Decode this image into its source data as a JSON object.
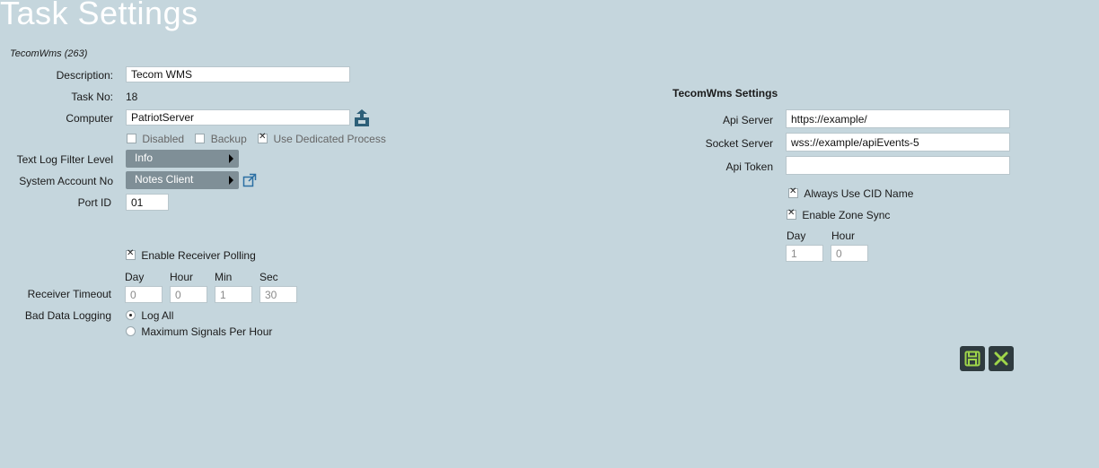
{
  "page": {
    "title": "Task Settings",
    "subtitle": "TecomWms (263)"
  },
  "left": {
    "description": {
      "label": "Description:",
      "value": "Tecom WMS"
    },
    "task_no": {
      "label": "Task No:",
      "value": "18"
    },
    "computer": {
      "label": "Computer",
      "value": "PatriotServer"
    },
    "options": {
      "disabled": {
        "label": "Disabled",
        "checked": false
      },
      "backup": {
        "label": "Backup",
        "checked": false
      },
      "dedicated": {
        "label": "Use Dedicated Process",
        "checked": true
      }
    },
    "log_filter": {
      "label": "Text Log Filter Level",
      "value": "Info"
    },
    "system_account": {
      "label": "System Account No",
      "value": "Notes Client"
    },
    "port_id": {
      "label": "Port ID",
      "value": "01"
    },
    "receiver_polling": {
      "label": "Enable Receiver Polling",
      "checked": true
    },
    "timeout_units": {
      "day": "Day",
      "hour": "Hour",
      "min": "Min",
      "sec": "Sec"
    },
    "receiver_timeout": {
      "label": "Receiver Timeout",
      "day": "0",
      "hour": "0",
      "min": "1",
      "sec": "30"
    },
    "bad_data": {
      "label": "Bad Data Logging",
      "log_all": "Log All",
      "max_signals": "Maximum Signals Per Hour",
      "selected": "log_all"
    }
  },
  "right": {
    "section_title": "TecomWms Settings",
    "api_server": {
      "label": "Api Server",
      "value": "https://example/"
    },
    "socket_server": {
      "label": "Socket Server",
      "value": "wss://example/apiEvents-5"
    },
    "api_token": {
      "label": "Api Token",
      "value": ""
    },
    "always_cid": {
      "label": "Always Use CID Name",
      "checked": true
    },
    "zone_sync": {
      "label": "Enable Zone Sync",
      "checked": true
    },
    "sync_units": {
      "day": "Day",
      "hour": "Hour"
    },
    "sync_interval": {
      "day": "1",
      "hour": "0"
    }
  },
  "actions": {
    "save_icon": "save-icon",
    "cancel_icon": "close-icon"
  },
  "colors": {
    "background": "#c5d6dd",
    "dropdown": "#7f8f97",
    "button": "#2f3b3f",
    "accent": "#9fd64a"
  }
}
